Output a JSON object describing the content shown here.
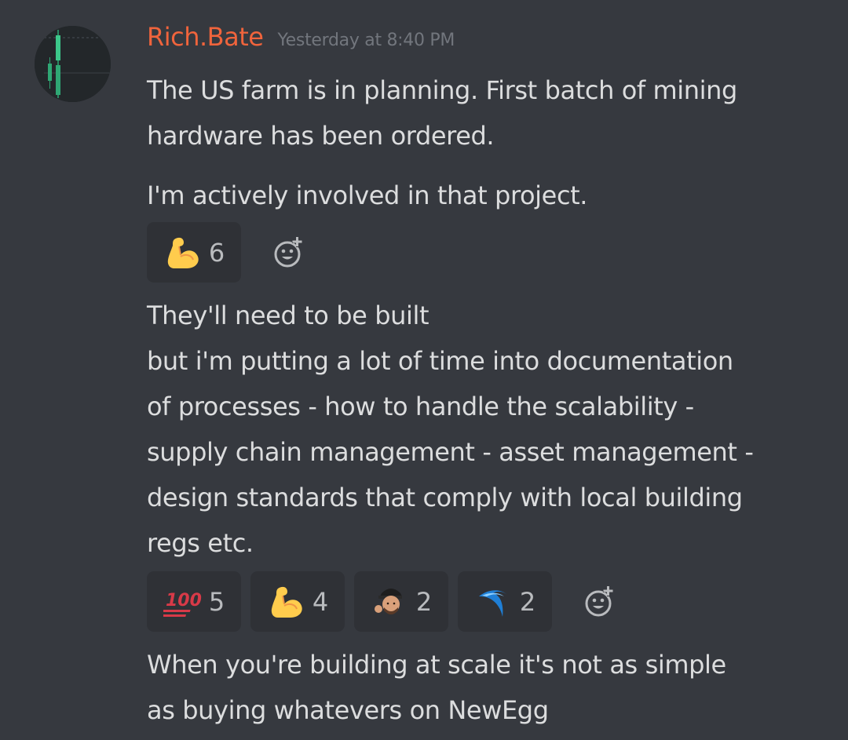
{
  "message": {
    "author": {
      "username": "Rich.Bate",
      "username_color": "#f0643c",
      "avatar_icon": "candlestick-chart-avatar"
    },
    "timestamp": "Yesterday at 8:40 PM",
    "lines": {
      "first": "The US farm is in planning. First batch of mining\nhardware has been ordered.",
      "second": "I'm actively involved in that project.",
      "third": "They'll need to be built\nbut i'm putting a lot of time into documentation\nof processes - how to handle the scalability -\nsupply chain management - asset management -\ndesign standards that comply with local building\nregs etc.",
      "fourth": "When you're building at scale it's not as simple\nas buying whatevers on NewEgg"
    },
    "reactions_row_1": [
      {
        "emoji": "flexed-biceps",
        "count": "6"
      }
    ],
    "reactions_row_2": [
      {
        "emoji": "hundred-points",
        "count": "5"
      },
      {
        "emoji": "flexed-biceps",
        "count": "4"
      },
      {
        "emoji": "custom-person-emoji",
        "count": "2"
      },
      {
        "emoji": "custom-blue-swoosh-emoji",
        "count": "2"
      }
    ],
    "add_reaction_icon": "add-reaction-icon"
  },
  "theme": {
    "background": "#36393f",
    "text": "#dcddde",
    "muted": "#72767d",
    "reaction_bg": "#2f3136"
  }
}
